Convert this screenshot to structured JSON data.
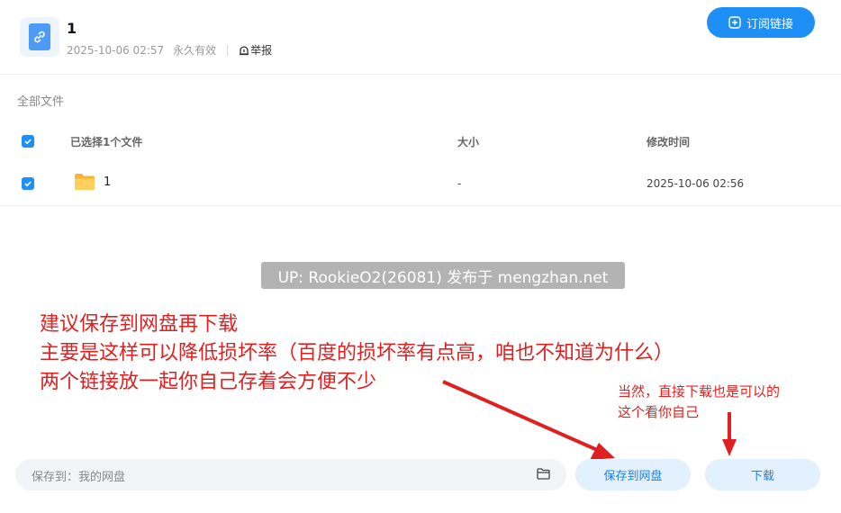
{
  "header": {
    "title": "1",
    "date": "2025-10-06 02:57",
    "validity": "永久有效",
    "report_label": "举报",
    "subscribe_label": "订阅链接"
  },
  "breadcrumb": "全部文件",
  "table": {
    "headers": {
      "name": "已选择1个文件",
      "size": "大小",
      "modified": "修改时间"
    },
    "rows": [
      {
        "name": "1",
        "size": "-",
        "modified": "2025-10-06 02:56",
        "checked": true,
        "icon": "folder-icon"
      }
    ]
  },
  "watermark": "UP: RookieO2(26081) 发布于 mengzhan.net",
  "annotation": {
    "line1": "建议保存到网盘再下载",
    "line2": "主要是这样可以降低损坏率（百度的损坏率有点高，咱也不知道为什么）",
    "line3": "两个链接放一起你自己存着会方便不少",
    "right_line1": "当然，直接下载也是可以的",
    "right_line2": "这个看你自己",
    "color": "#e02020"
  },
  "bottom": {
    "save_path": "保存到：我的网盘",
    "save_button": "保存到网盘",
    "download_button": "下载"
  },
  "colors": {
    "accent": "#1e90f5",
    "pill_bg": "#e3f1fe"
  }
}
